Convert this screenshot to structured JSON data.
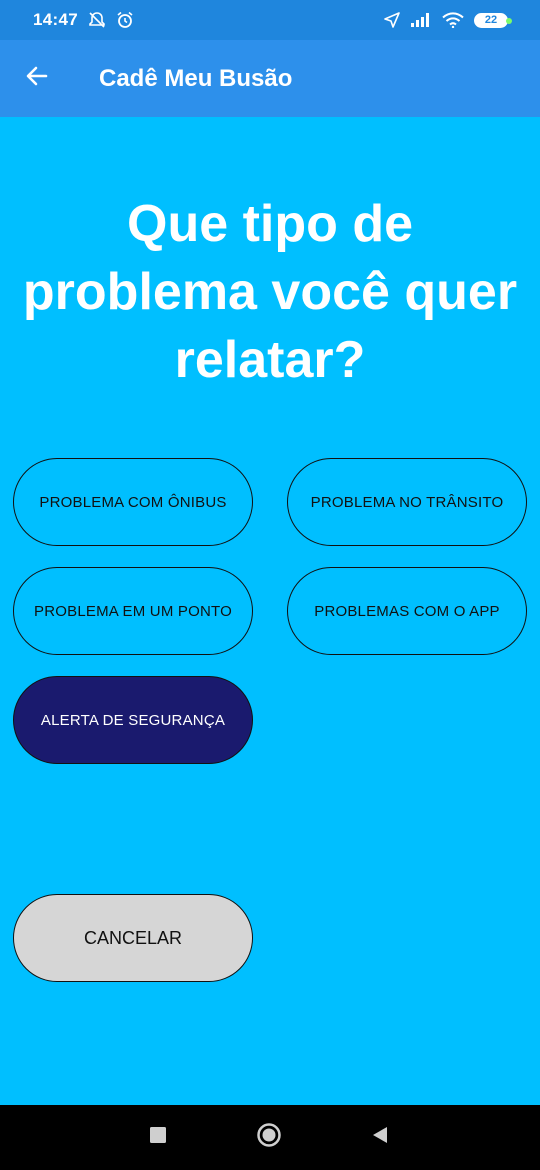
{
  "status_bar": {
    "time": "14:47",
    "battery": "22",
    "icons": [
      "muted-alarm-icon",
      "alarm-icon",
      "location-arrow-icon",
      "signal-icon",
      "wifi-icon",
      "battery-icon"
    ]
  },
  "app_bar": {
    "title": "Cadê Meu Busão",
    "back_icon": "arrow-left-icon"
  },
  "question": {
    "text": "Que tipo de problema você quer relatar?"
  },
  "options": [
    {
      "label": "PROBLEMA COM ÔNIBUS"
    },
    {
      "label": "PROBLEMA NO TRÂNSITO"
    },
    {
      "label": "PROBLEMA EM UM PONTO"
    },
    {
      "label": "PROBLEMAS COM O APP"
    },
    {
      "label": "ALERTA DE SEGURANÇA"
    }
  ],
  "cancel": {
    "label": "CANCELAR"
  },
  "colors": {
    "background": "#00BFFF",
    "app_bar": "#2D90EB",
    "status_bar": "#1F86DD",
    "alert_button": "#1A1A6E",
    "cancel_button": "#D6D6D6"
  },
  "nav_bar": {
    "icons": [
      "recent-apps-icon",
      "home-icon",
      "back-triangle-icon"
    ]
  }
}
